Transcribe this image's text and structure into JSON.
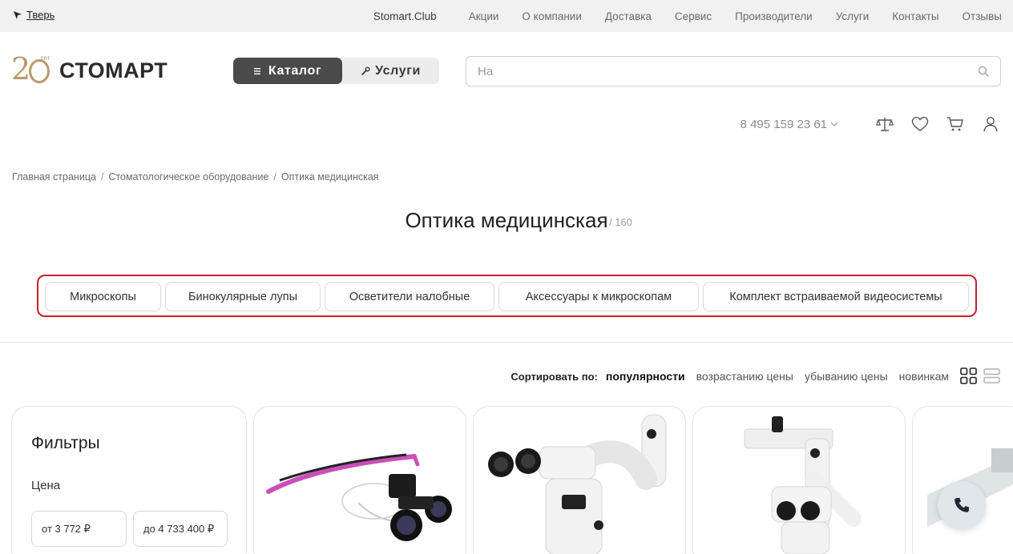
{
  "topbar": {
    "city": "Тверь",
    "nav": [
      "Stomart.Club",
      "Акции",
      "О компании",
      "Доставка",
      "Сервис",
      "Производители",
      "Услуги",
      "Контакты",
      "Отзывы"
    ]
  },
  "header": {
    "logo_years": "лет",
    "logo_text": "СТОМАРТ",
    "catalog_label": "Каталог",
    "services_label": "Услуги",
    "search_value": "",
    "search_placeholder": "На",
    "phone": "8 495 159 23 61"
  },
  "breadcrumb": [
    "Главная страница",
    "Стоматологическое оборудование",
    "Оптика медицинская"
  ],
  "page": {
    "title": "Оптика медицинская",
    "count": "/ 160"
  },
  "categories": [
    "Микроскопы",
    "Бинокулярные лупы",
    "Осветители налобные",
    "Аксессуары к микроскопам",
    "Комплект встраиваемой видеосистемы"
  ],
  "sort": {
    "label": "Сортировать по:",
    "options": [
      "популярности",
      "возрастанию цены",
      "убыванию цены",
      "новинкам"
    ],
    "active": "популярности"
  },
  "filters": {
    "title": "Фильтры",
    "price_label": "Цена",
    "price_from": "от 3 772 ₽",
    "price_to": "до 4 733 400 ₽"
  },
  "colors": {
    "accent_gold": "#b99a6b",
    "highlight_red": "#c8202f",
    "dark_button": "#4a4a4a"
  }
}
